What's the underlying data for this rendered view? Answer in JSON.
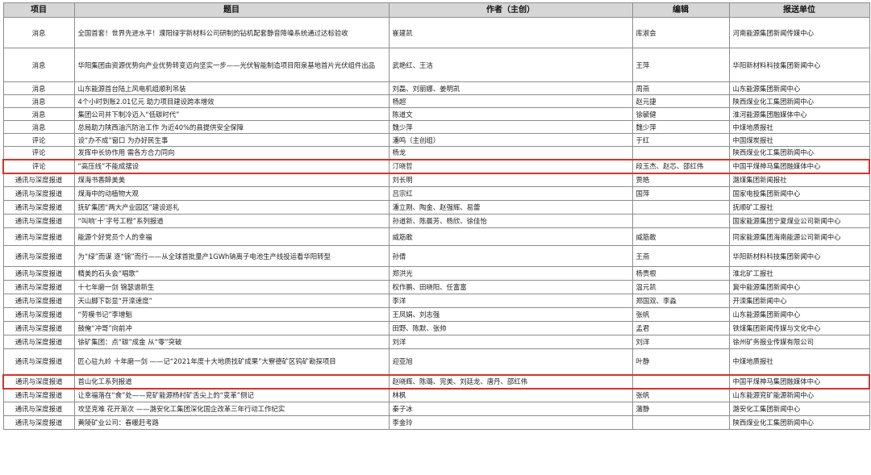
{
  "headers": [
    "项目",
    "题目",
    "作者（主创）",
    "编辑",
    "报送单位"
  ],
  "rows": [
    {
      "type": "消息",
      "title": "全国首套！世界先进水平！濮阳绿宇新材料公司研制的钻机配套静音降噪系统通过达标验收",
      "author": "崔建凯",
      "editor": "库淑会",
      "unit": "河南能源集团新闻传媒中心"
    },
    {
      "type": "消息",
      "title": "华阳集团由资源优势向产业优势转变迈向坚实一步——光伏智能制造项目阳泉基地首片光伏组件出品",
      "author": "武艳红、王洁",
      "editor": "王萍",
      "unit": "华阳新材料科技集团新闻中心"
    },
    {
      "type": "消息",
      "title": "山东能源首台陆上风电机组顺利吊装",
      "author": "刘磊、刘丽娜、姜明凯",
      "editor": "周燕",
      "unit": "山东能源集团新闻中心"
    },
    {
      "type": "消息",
      "title": "4个小时到账2.01亿元 助力项目建设跨本增效",
      "author": "杨超",
      "editor": "赵元捷",
      "unit": "陕西煤业化工集团新闻中心"
    },
    {
      "type": "消息",
      "title": "集团公司井下制冷迈入“低碳时代”",
      "author": "陈道文",
      "editor": "徐毓健",
      "unit": "淮河能源集团融媒体中心"
    },
    {
      "type": "消息",
      "title": "总局助力陕西油汽防治工作 为近40%的县提供安全保障",
      "author": "魏少萍",
      "editor": "魏少萍",
      "unit": "中煤地质报社"
    },
    {
      "type": "评论",
      "title": "设“办不成”窗口 为办好民生事",
      "author": "潘鸣（主创组）",
      "editor": "于红",
      "unit": "中国煤炭报社"
    },
    {
      "type": "评论",
      "title": "发挥中长协作用 需各方合力同向",
      "author": "杨龙",
      "editor": "",
      "unit": "陕西煤业化工集团新闻中心"
    },
    {
      "type": "评论",
      "title": "“高压线”不能成摆设",
      "author": "汀晓哲",
      "editor": "段玉杰、赵芯、邵红伟",
      "unit": "中国平煤神马集团融媒体中心",
      "hl": true
    },
    {
      "type": "通讯与深度报道",
      "title": "煤海书香醉美美",
      "author": "刘长明",
      "editor": "贾皓",
      "unit": "潞煤集团新闻报社"
    },
    {
      "type": "通讯与深度报道",
      "title": "煤海中的动植物大观",
      "author": "吕宗红",
      "editor": "国萍",
      "unit": "国家电投集团新闻中心"
    },
    {
      "type": "通讯与深度报道",
      "title": "抚矿集团“两大产业园区”建设巡礼",
      "author": "潘立刚、陶金、赵强辉、易蕾",
      "editor": "",
      "unit": "抚顺矿工报社"
    },
    {
      "type": "通讯与深度报道",
      "title": "“叫响‘十’字号工程”系列报道",
      "author": "孙道新、陈晨芳、杨欣、徐佳怡",
      "editor": "",
      "unit": "国家能源集团宁夏煤业公司新闻中心"
    },
    {
      "type": "通讯与深度报道",
      "title": "能源个好党员个人的幸福",
      "author": "威筋敢",
      "editor": "威筋敢",
      "unit": "同家能源集团海南能源公司新闻中心"
    },
    {
      "type": "通讯与深度报道",
      "title": "为“绿”而谋 逐“锦”而行——从全球首批量产1GWh钠离子电池生产线投运看华阳转型",
      "author": "孙倩",
      "editor": "王燕",
      "unit": "华阳新材料科技集团新闻中心"
    },
    {
      "type": "通讯与深度报道",
      "title": "精美的石头会“唱歌”",
      "author": "郑洪光",
      "editor": "杨贵根",
      "unit": "淮北矿工报社"
    },
    {
      "type": "通讯与深度报道",
      "title": "十七年磨一剑 锦瑟谱新生",
      "author": "权作鹏、田晓阳、任富富",
      "editor": "温元凯",
      "unit": "冀中能源集团新闻中心"
    },
    {
      "type": "通讯与深度报道",
      "title": "天山脚下彰显“开滦速度”",
      "author": "李洋",
      "editor": "郑国双、李淼",
      "unit": "开滦集团新闻中心"
    },
    {
      "type": "通讯与深度报道",
      "title": "“劳模书记”李增魁",
      "author": "王凤娟、刘志强",
      "editor": "张帆",
      "unit": "山东能源集团新闻中心"
    },
    {
      "type": "通讯与深度报道",
      "title": "鼓俺“冲哥”向前冲",
      "author": "田野、陈默、张帅",
      "editor": "孟君",
      "unit": "铁煤集团新闻传媒与文化中心"
    },
    {
      "type": "通讯与深度报道",
      "title": "徐矿集团：点“碳”成金 从“零”突破",
      "author": "刘洋",
      "editor": "刘洋",
      "unit": "徐州矿务报业传媒有限公司"
    },
    {
      "type": "通讯与深度报道",
      "title": "匠心驻九岭 十年磨一剑 ——记“2021年度十大地质找矿成果”大竂德矿区钨矿勘探项目",
      "author": "迎亚旭",
      "editor": "叶静",
      "unit": "中煤地质报社"
    },
    {
      "type": "通讯与深度报道",
      "title": "首山化工系列报道",
      "author": "赵晓辉、陈璐、完美、刘廷龙、唐丹、邵红伟",
      "editor": "",
      "unit": "中国平煤神马集团融媒体中心",
      "hl": true
    },
    {
      "type": "通讯与深度报道",
      "title": "让幸福落在“食”处——兖矿能源杨村矿舌尖上的“变革”侧记",
      "author": "林枫",
      "editor": "张帆",
      "unit": "山东能源兖矿能源新闻中心"
    },
    {
      "type": "通讯与深度报道",
      "title": "攻坚克难 花开渐次 ——潞安化工集团深化国企改革三年行动工作纪实",
      "author": "秦子冰",
      "editor": "蒲静",
      "unit": "潞安化工集团新闻中心"
    },
    {
      "type": "通讯与深度报道",
      "title": "黄陵矿业公司：春暖赶考路",
      "author": "李金玲",
      "editor": "",
      "unit": "陕西煤业化工集团新闻中心"
    }
  ]
}
